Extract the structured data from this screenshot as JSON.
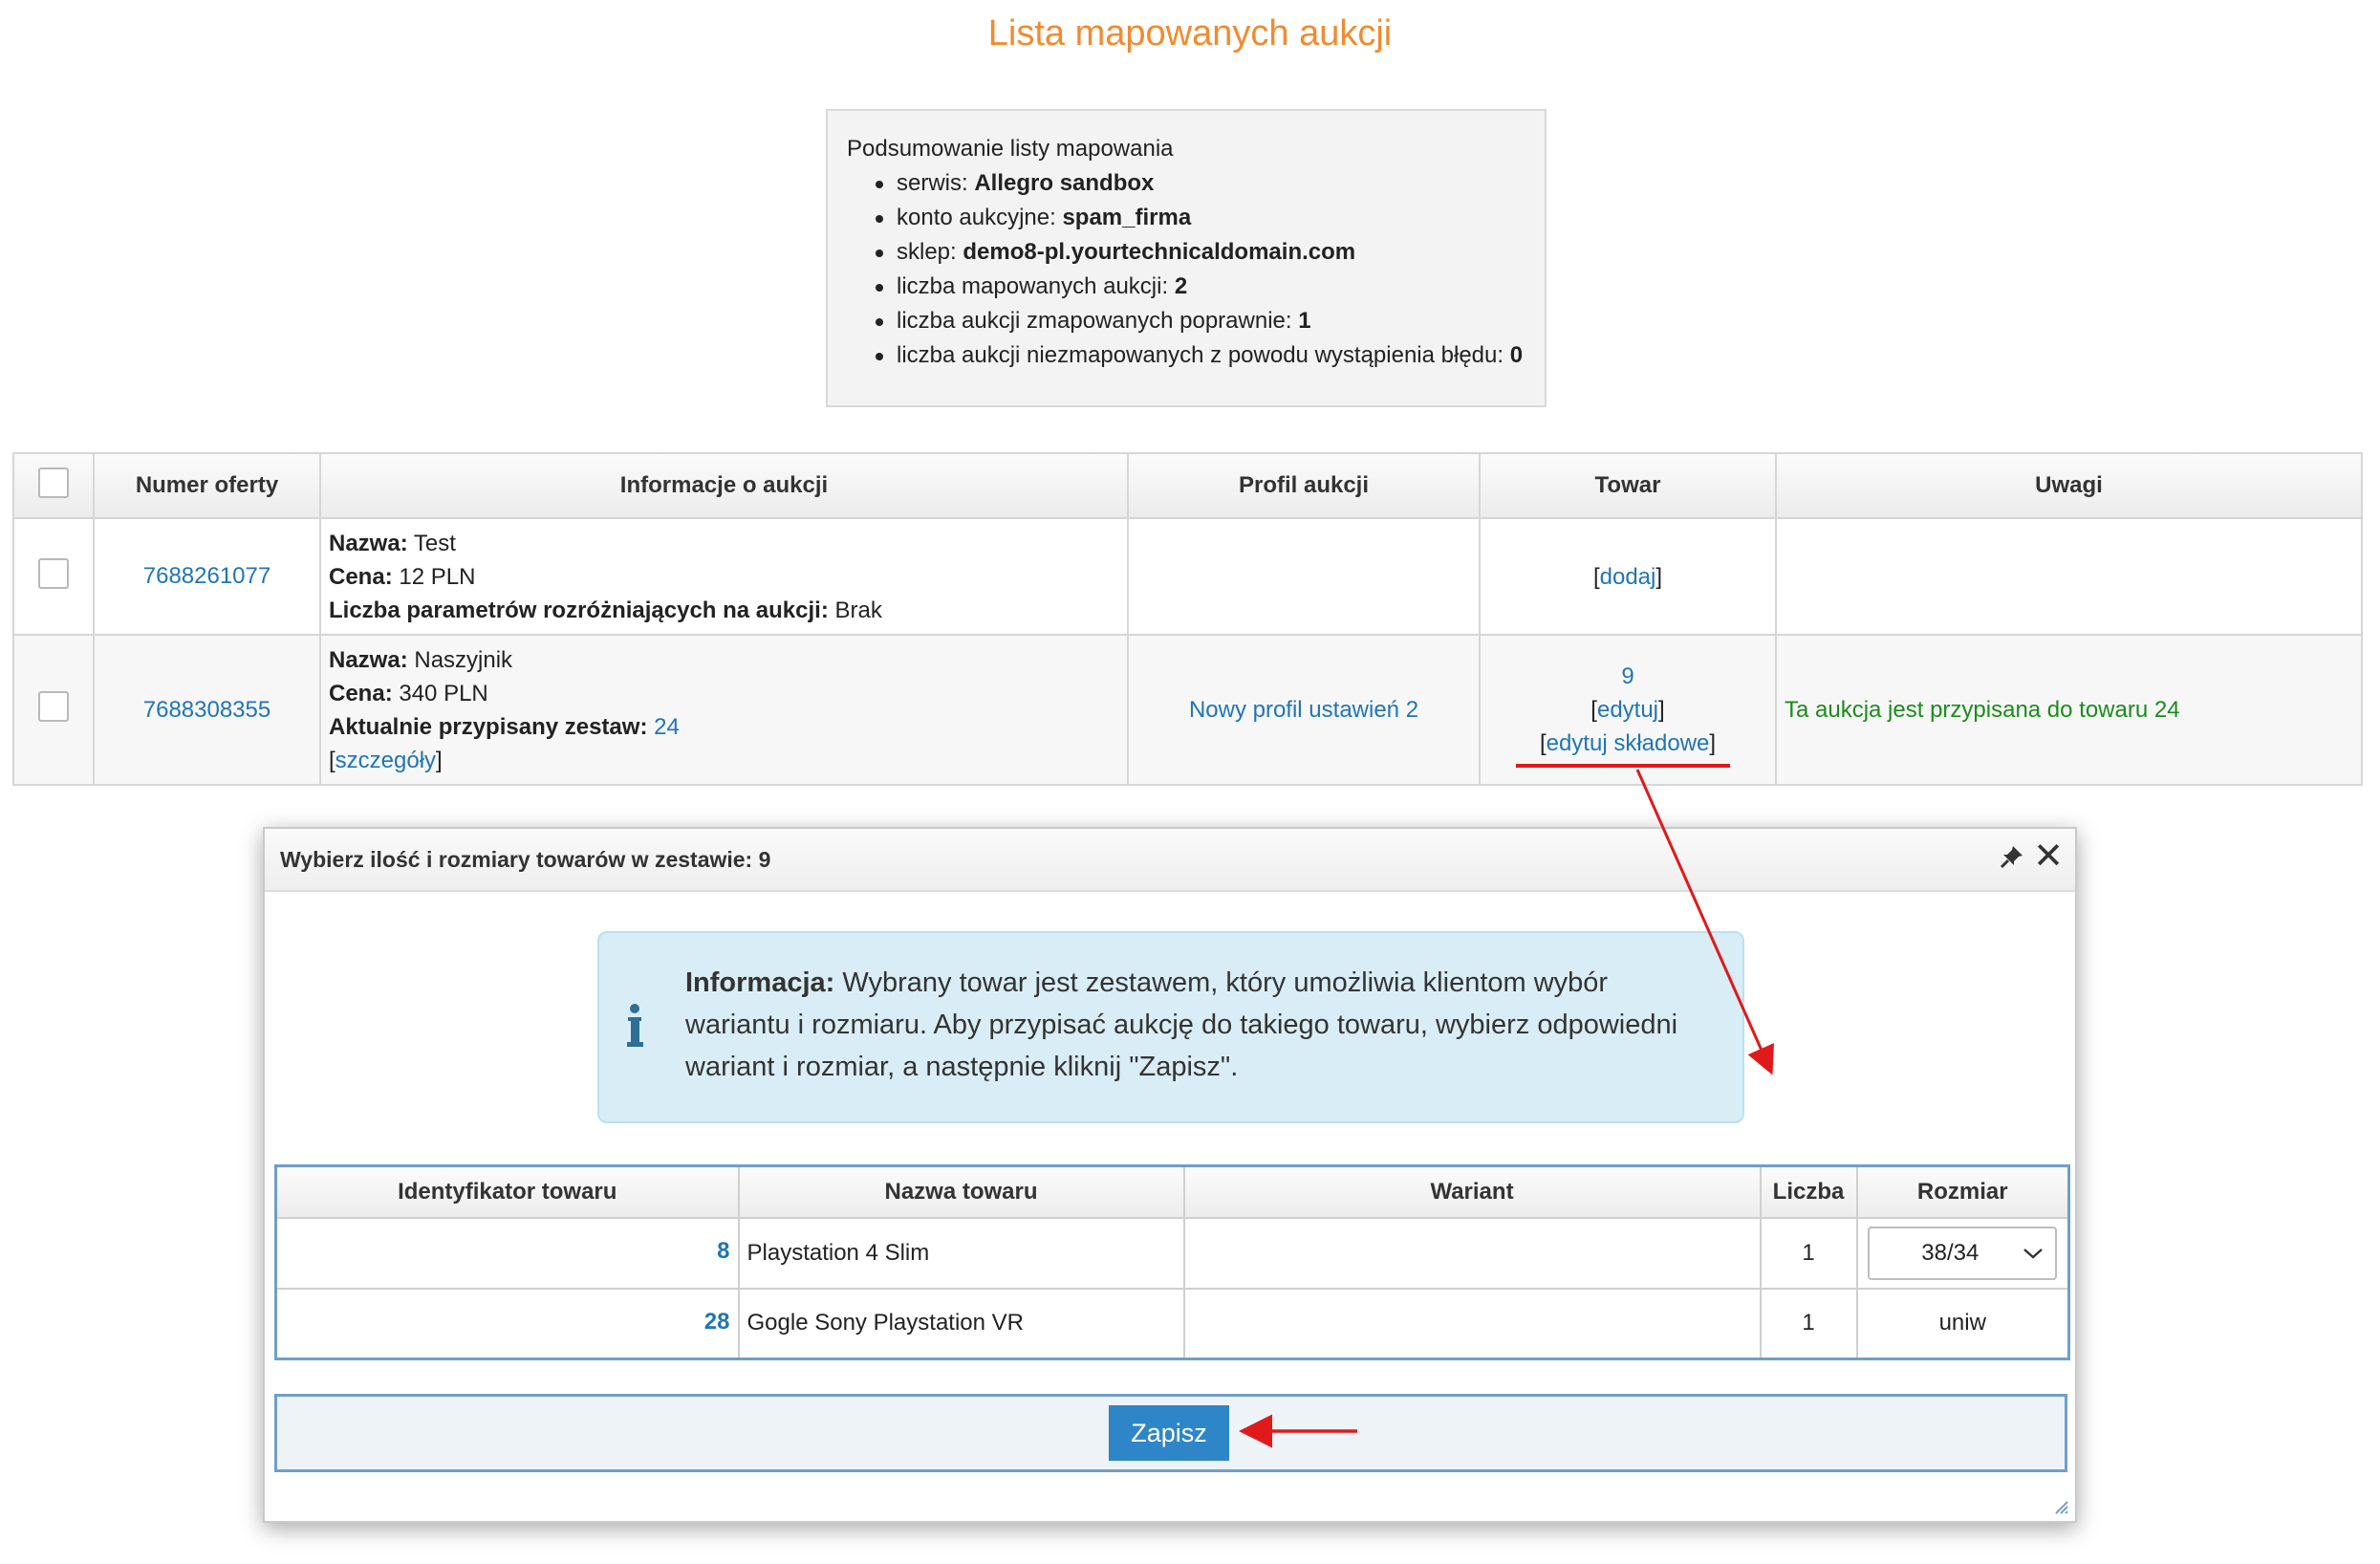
{
  "page": {
    "title": "Lista mapowanych aukcji"
  },
  "summary": {
    "heading": "Podsumowanie listy mapowania",
    "items": [
      {
        "label": "serwis: ",
        "value": "Allegro sandbox"
      },
      {
        "label": "konto aukcyjne: ",
        "value": "spam_firma"
      },
      {
        "label": "sklep: ",
        "value": "demo8-pl.yourtechnicaldomain.com"
      },
      {
        "label": "liczba mapowanych aukcji: ",
        "value": "2"
      },
      {
        "label": "liczba aukcji zmapowanych poprawnie: ",
        "value": "1"
      },
      {
        "label": "liczba aukcji niezmapowanych z powodu wystąpienia błędu: ",
        "value": "0"
      }
    ]
  },
  "table": {
    "headers": [
      "Numer oferty",
      "Informacje o aukcji",
      "Profil aukcji",
      "Towar",
      "Uwagi"
    ],
    "rows": [
      {
        "offer": "7688261077",
        "name_label": "Nazwa:",
        "name": " Test",
        "price_label": "Cena:",
        "price": " 12 PLN",
        "param_label": "Liczba parametrów rozróżniających na aukcji:",
        "param": " Brak",
        "profile": "",
        "towar_link": "dodaj",
        "note": ""
      },
      {
        "offer": "7688308355",
        "name_label": "Nazwa:",
        "name": " Naszyjnik",
        "price_label": "Cena:",
        "price": " 340 PLN",
        "set_label": "Aktualnie przypisany zestaw:",
        "set_value": "24",
        "details_link": "szczegóły",
        "profile": "Nowy profil ustawień 2",
        "towar_id": "9",
        "edit_link": "edytuj",
        "edit_components_link": "edytuj składowe",
        "note": "Ta aukcja jest przypisana do towaru 24"
      }
    ]
  },
  "dialog": {
    "title": "Wybierz ilość i rozmiary towarów w zestawie: 9",
    "alert_label": "Informacja:",
    "alert_text": " Wybrany towar jest zestawem, który umożliwia klientom wybór wariantu i rozmiaru. Aby przypisać aukcję do takiego towaru, wybierz odpowiedni wariant i rozmiar, a następnie kliknij \"Zapisz\".",
    "headers": [
      "Identyfikator towaru",
      "Nazwa towaru",
      "Wariant",
      "Liczba",
      "Rozmiar"
    ],
    "rows": [
      {
        "id": "8",
        "name": "Playstation 4 Slim",
        "variant": "",
        "qty": "1",
        "size": "38/34",
        "size_is_select": true
      },
      {
        "id": "28",
        "name": "Gogle Sony Playstation VR",
        "variant": "",
        "qty": "1",
        "size": "uniw",
        "size_is_select": false
      }
    ],
    "save_label": "Zapisz"
  },
  "colors": {
    "title": "#f18b2e",
    "link": "#1f75b7",
    "ok": "#1c8b1c",
    "annotation": "#e0191b",
    "button": "#2e86c8"
  }
}
